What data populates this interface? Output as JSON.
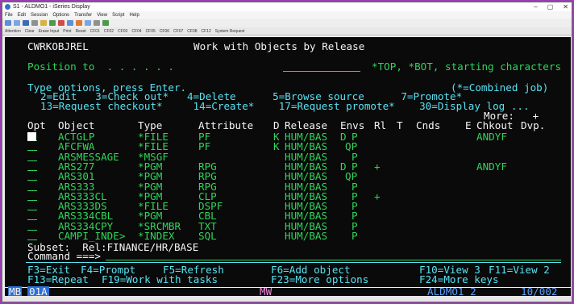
{
  "window": {
    "title": "S1 - ALDMO1 - iSeries Display",
    "controls": {
      "minimize": "–",
      "maximize": "▢",
      "close": "✕"
    }
  },
  "menu": [
    "File",
    "Edit",
    "Session",
    "Options",
    "Transfer",
    "View",
    "Script",
    "Help"
  ],
  "keybar": [
    "Attention",
    "Clear",
    "Erase Input",
    "Print",
    "Reset",
    "CF01",
    "CF02",
    "CF03",
    "CF04",
    "CF05",
    "CF06",
    "CF07",
    "CF08",
    "CF12",
    "System Request"
  ],
  "screen": {
    "program": "CWRKOBJREL",
    "title": "Work with Objects by Release",
    "position_label": "Position to  . . . . . .",
    "position_hint": "*TOP, *BOT, starting characters",
    "type_options": "Type options, press Enter.",
    "combined_note": "(*=Combined job)",
    "opt_line1": "2=Edit   3=Check out*   4=Delete      5=Browse source      7=Promote*",
    "opt_line2": "13=Request checkout*     14=Create*    17=Request promote*    30=Display log ...",
    "more": "More:   +",
    "headers": {
      "opt": "Opt",
      "object": "Object",
      "type": "Type",
      "attribute": "Attribute",
      "d": "D",
      "release": "Release",
      "envs": "Envs",
      "rl": "Rl",
      "t": "T",
      "cnds": "Cnds",
      "e": "E",
      "chkout": "Chkout",
      "dvp": "Dvp."
    },
    "rows": [
      {
        "object": "ACTGLP",
        "type": "*FILE",
        "attribute": "PF",
        "d": "K",
        "release": "HUM/BAS",
        "env1": "D",
        "env2": "P",
        "rl": "",
        "chkout": "ANDYF"
      },
      {
        "object": "AFCFWA",
        "type": "*FILE",
        "attribute": "PF",
        "d": "K",
        "release": "HUM/BAS",
        "env1": "",
        "env2": "QP",
        "rl": "",
        "chkout": ""
      },
      {
        "object": "ARSMESSAGE",
        "type": "*MSGF",
        "attribute": "",
        "d": "",
        "release": "HUM/BAS",
        "env1": "",
        "env2": "P",
        "rl": "",
        "chkout": ""
      },
      {
        "object": "ARS277",
        "type": "*PGM",
        "attribute": "RPG",
        "d": "",
        "release": "HUM/BAS",
        "env1": "D",
        "env2": "P",
        "rl": "+",
        "chkout": "ANDYF"
      },
      {
        "object": "ARS301",
        "type": "*PGM",
        "attribute": "RPG",
        "d": "",
        "release": "HUM/BAS",
        "env1": "",
        "env2": "QP",
        "rl": "",
        "chkout": ""
      },
      {
        "object": "ARS333",
        "type": "*PGM",
        "attribute": "RPG",
        "d": "",
        "release": "HUM/BAS",
        "env1": "",
        "env2": "P",
        "rl": "",
        "chkout": ""
      },
      {
        "object": "ARS333CL",
        "type": "*PGM",
        "attribute": "CLP",
        "d": "",
        "release": "HUM/BAS",
        "env1": "",
        "env2": "P",
        "rl": "+",
        "chkout": ""
      },
      {
        "object": "ARS333DS",
        "type": "*FILE",
        "attribute": "DSPF",
        "d": "",
        "release": "HUM/BAS",
        "env1": "",
        "env2": "P",
        "rl": "",
        "chkout": ""
      },
      {
        "object": "ARS334CBL",
        "type": "*PGM",
        "attribute": "CBL",
        "d": "",
        "release": "HUM/BAS",
        "env1": "",
        "env2": "P",
        "rl": "",
        "chkout": ""
      },
      {
        "object": "ARS334CPY",
        "type": "*SRCMBR",
        "attribute": "TXT",
        "d": "",
        "release": "HUM/BAS",
        "env1": "",
        "env2": "P",
        "rl": "",
        "chkout": ""
      },
      {
        "object": "CAMPI_INDE>",
        "type": "*INDEX",
        "attribute": "SQL",
        "d": "",
        "release": "HUM/BAS",
        "env1": "",
        "env2": "P",
        "rl": "",
        "chkout": ""
      }
    ],
    "subset": "Subset:  Rel:FINANCE/HR/BASE",
    "command_label": "Command ===>",
    "fkeys1": [
      "F3=Exit",
      "F4=Prompt",
      "F5=Refresh",
      "F6=Add object",
      "F10=View 3",
      "F11=View 2"
    ],
    "fkeys2": [
      "F13=Repeat",
      "F19=Work with tasks",
      "F23=More options",
      "F24=More keys"
    ]
  },
  "status": {
    "mode": "MB",
    "indicator": "01A",
    "mw": "MW",
    "session": "ALDMO1_2",
    "cursor_pos": "10/002"
  }
}
